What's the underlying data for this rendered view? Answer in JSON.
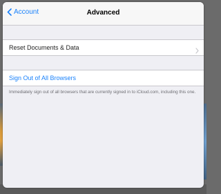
{
  "nav": {
    "back_label": "Account",
    "title": "Advanced"
  },
  "rows": {
    "reset_label": "Reset Documents & Data",
    "signout_label": "Sign Out of All Browsers"
  },
  "footer": {
    "note": "Immediately sign out of all browsers that are currently signed in to iCloud.com, including this one."
  },
  "icons": {
    "back": "chevron-left-icon",
    "disclosure": "chevron-right-icon"
  },
  "colors": {
    "accent": "#1a82fb",
    "background": "#efeff4",
    "separator": "#c8c7cc",
    "footer_text": "#6d6d72"
  }
}
